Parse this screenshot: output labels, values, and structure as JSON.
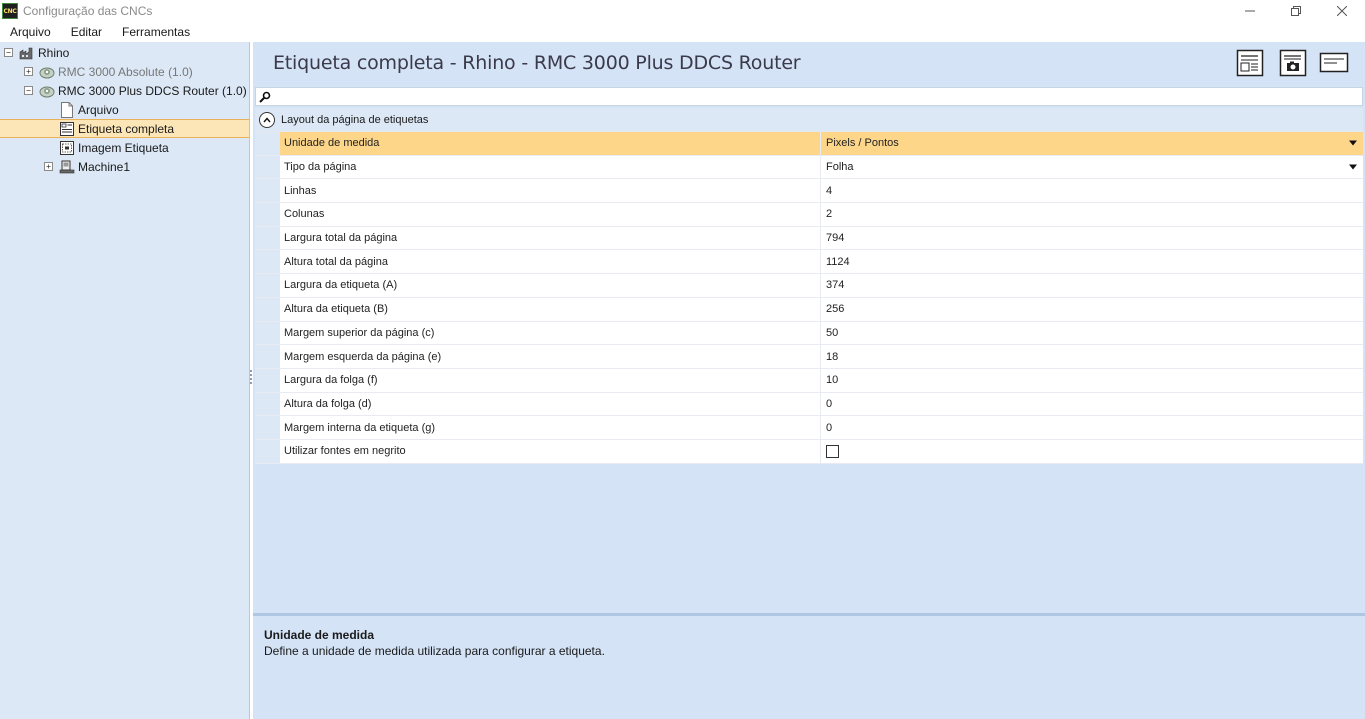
{
  "window": {
    "title": "Configuração das CNCs",
    "icon_text": "CNC"
  },
  "menu": [
    "Arquivo",
    "Editar",
    "Ferramentas"
  ],
  "tree": {
    "root": "Rhino",
    "machine_absolute": "RMC 3000 Absolute (1.0)",
    "machine_plus": "RMC 3000 Plus DDCS Router (1.0)",
    "file": "Arquivo",
    "label_full": "Etiqueta completa",
    "label_image": "Imagem Etiqueta",
    "machine1": "Machine1"
  },
  "main": {
    "title": "Etiqueta completa - Rhino - RMC 3000 Plus DDCS Router"
  },
  "grid": {
    "category": "Layout da página de etiquetas",
    "rows": [
      {
        "name": "Unidade de medida",
        "value": "Pixels / Pontos"
      },
      {
        "name": "Tipo da página",
        "value": "Folha"
      },
      {
        "name": "Linhas",
        "value": "4"
      },
      {
        "name": "Colunas",
        "value": "2"
      },
      {
        "name": "Largura total da página",
        "value": "794"
      },
      {
        "name": "Altura total da página",
        "value": "1124"
      },
      {
        "name": "Largura da etiqueta (A)",
        "value": "374"
      },
      {
        "name": "Altura da etiqueta (B)",
        "value": "256"
      },
      {
        "name": "Margem superior da página (c)",
        "value": "50"
      },
      {
        "name": "Margem esquerda da página (e)",
        "value": "18"
      },
      {
        "name": "Largura da folga (f)",
        "value": "10"
      },
      {
        "name": "Altura da folga (d)",
        "value": "0"
      },
      {
        "name": "Margem interna da etiqueta (g)",
        "value": "0"
      },
      {
        "name": "Utilizar fontes em negrito",
        "value": ""
      }
    ]
  },
  "description": {
    "title": "Unidade de medida",
    "text": "Define a unidade de medida utilizada para configurar a etiqueta."
  },
  "colors": {
    "selected_row": "#fdd68a",
    "panel_bg": "#d4e3f6",
    "tree_bg": "#dce8f6",
    "tree_selected": "#fce5b6"
  }
}
